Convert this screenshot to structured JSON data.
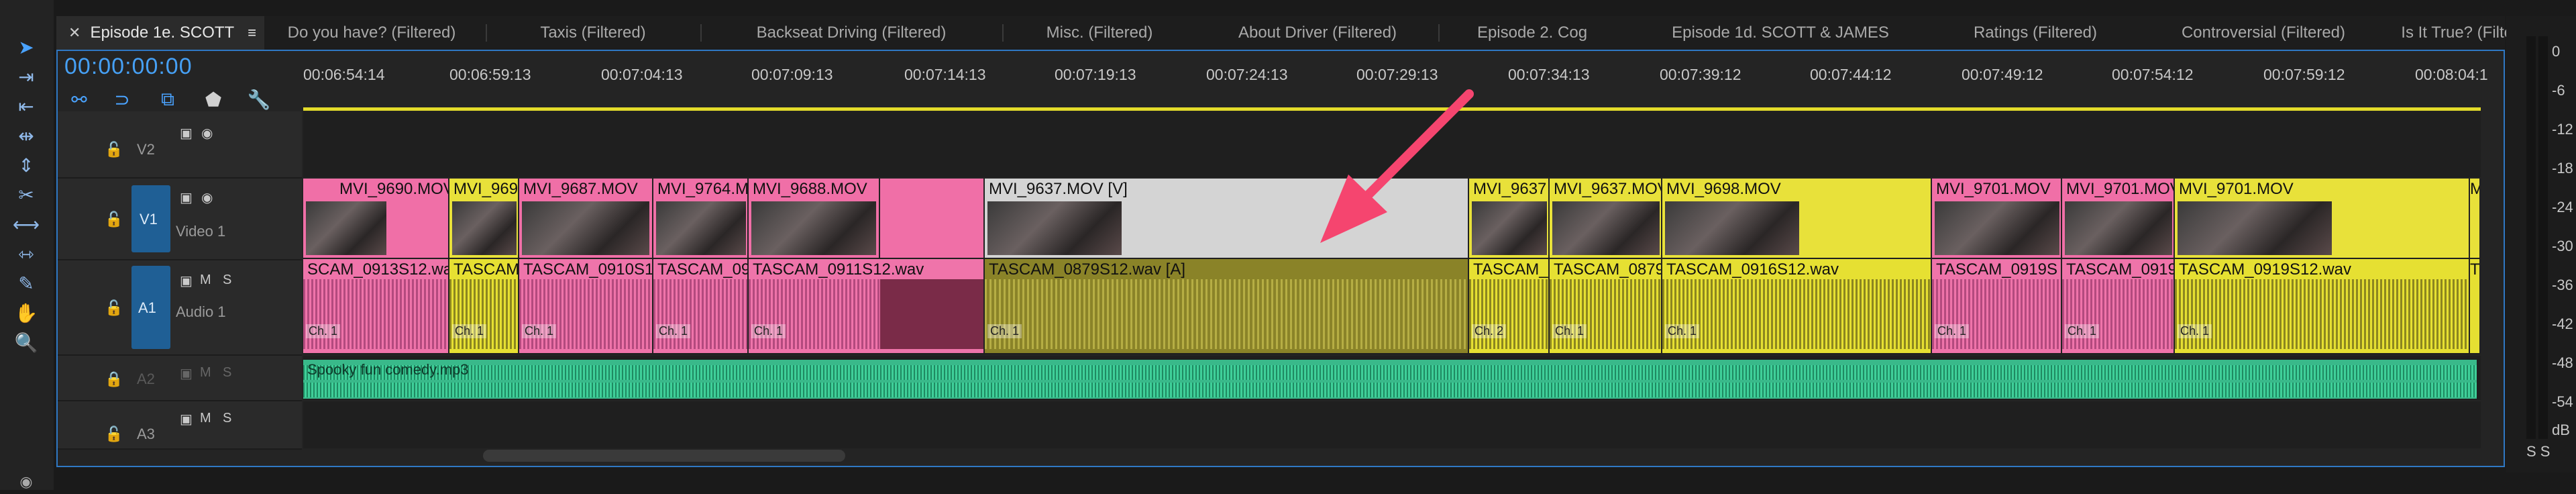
{
  "sequence": {
    "active_tab": "Episode 1e. SCOTT",
    "tabs": [
      "Do you have? (Filtered)",
      "Taxis (Filtered)",
      "Backseat Driving (Filtered)",
      "Misc. (Filtered)",
      "About Driver (Filtered)",
      "Episode 2. Cog",
      "Episode 1d. SCOTT & JAMES",
      "Ratings (Filtered)",
      "Controversial (Filtered)",
      "Is It True? (Filtered)"
    ],
    "timecode": "00:00:00:00"
  },
  "ruler": {
    "ticks": [
      "00:06:54:14",
      "00:06:59:13",
      "00:07:04:13",
      "00:07:09:13",
      "00:07:14:13",
      "00:07:19:13",
      "00:07:24:13",
      "00:07:29:13",
      "00:07:34:13",
      "00:07:39:12",
      "00:07:44:12",
      "00:07:49:12",
      "00:07:54:12",
      "00:07:59:12",
      "00:08:04:1"
    ]
  },
  "tracks": {
    "v2": {
      "id": "V2"
    },
    "v1": {
      "id": "V1",
      "name": "Video 1"
    },
    "a1": {
      "id": "A1",
      "name": "Audio 1",
      "m": "M",
      "s": "S"
    },
    "a2": {
      "id": "A2",
      "m": "M",
      "s": "S"
    },
    "a3": {
      "id": "A3",
      "m": "M",
      "s": "S"
    }
  },
  "video_clips": [
    "MVI_9690.MOV",
    "MVI_969",
    "MVI_9687.MOV",
    "MVI_9764.M",
    "MVI_9688.MOV",
    "",
    "MVI_9637.MOV [V]",
    "MVI_9637",
    "MVI_9637.MOV",
    "MVI_9698.MOV",
    "MVI_9701.MOV",
    "MVI_9701.MOV",
    "MVI_9701.MOV",
    "M"
  ],
  "audio_clips": [
    "SCAM_0913S12.wav",
    "TASCAM",
    "TASCAM_0910S12",
    "TASCAM_09",
    "TASCAM_0911S12.wav",
    "TASCAM_0879S12.wav [A]",
    "TASCAM_C",
    "TASCAM_0879",
    "TASCAM_0916S12.wav",
    "TASCAM_0919S",
    "TASCAM_0919",
    "TASCAM_0919S12.wav",
    "T"
  ],
  "channel_labels": [
    "Ch. 1",
    "Ch. 1",
    "Ch. 1",
    "Ch. 1",
    "Ch. 1",
    "Ch. 1",
    "Ch. 2",
    "Ch. 1",
    "Ch. 1",
    "Ch. 1",
    "Ch. 1",
    "Ch. 1"
  ],
  "music_clip": "Spooky fun comedy.mp3",
  "meter": {
    "ticks": [
      "0",
      "-6",
      "-12",
      "-18",
      "-24",
      "-30",
      "-36",
      "-42",
      "-48",
      "-54"
    ],
    "unit": "dB",
    "foot": "S  S"
  },
  "colors": {
    "accent": "#46a0f5",
    "video_pink": "#f06fa7",
    "video_yellow": "#e8e13a",
    "music_green": "#39b98a",
    "annotation_arrow": "#f5456f"
  }
}
